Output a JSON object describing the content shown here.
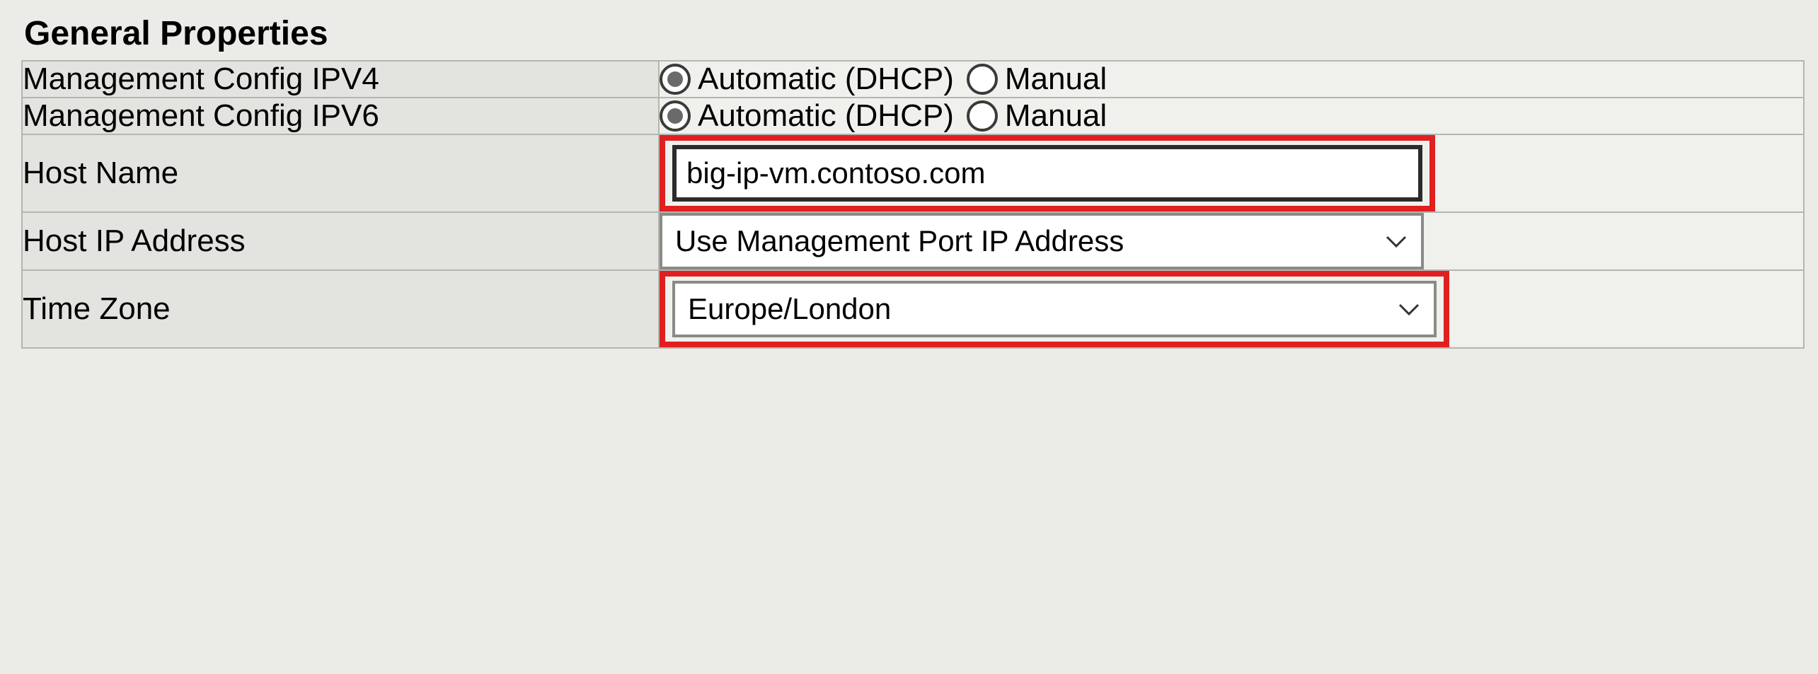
{
  "section_title": "General Properties",
  "rows": {
    "ipv4": {
      "label": "Management Config IPV4",
      "option_auto": "Automatic (DHCP)",
      "option_manual": "Manual"
    },
    "ipv6": {
      "label": "Management Config IPV6",
      "option_auto": "Automatic (DHCP)",
      "option_manual": "Manual"
    },
    "hostname": {
      "label": "Host Name",
      "value": "big-ip-vm.contoso.com"
    },
    "hostip": {
      "label": "Host IP Address",
      "selected": "Use Management Port IP Address"
    },
    "timezone": {
      "label": "Time Zone",
      "selected": "Europe/London"
    }
  }
}
